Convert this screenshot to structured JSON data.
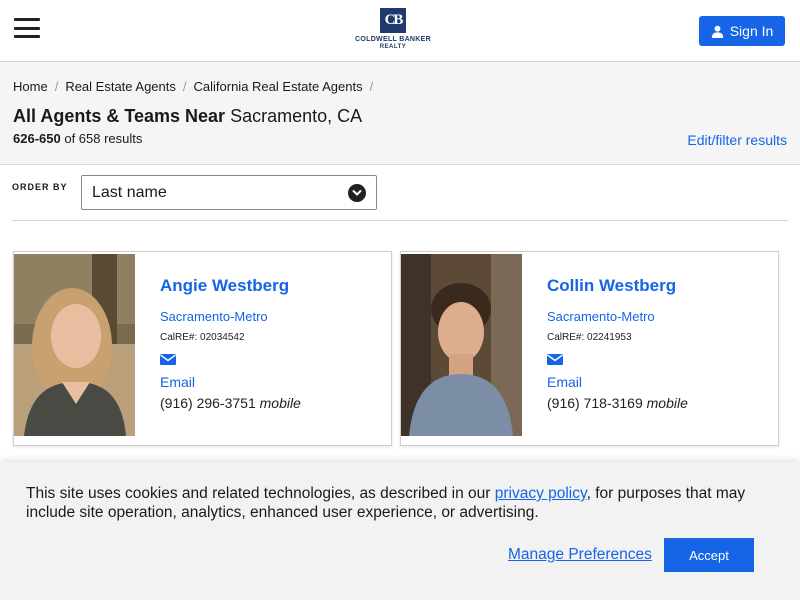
{
  "header": {
    "menu_icon": "hamburger-menu-icon",
    "logo": {
      "mark": "CB",
      "line1": "COLDWELL BANKER",
      "line2": "REALTY"
    },
    "signin_label": "Sign In",
    "signin_icon": "user-icon"
  },
  "breadcrumb": {
    "items": [
      "Home",
      "Real Estate Agents",
      "California Real Estate Agents"
    ],
    "separator": "/"
  },
  "summary": {
    "title_bold": "All Agents & Teams Near",
    "title_location": "Sacramento, CA",
    "range": "626-650",
    "of_text": "of 658 results",
    "edit_filter_label": "Edit/filter results"
  },
  "orderby": {
    "label": "ORDER BY",
    "selected": "Last name",
    "chevron_icon": "chevron-down-icon"
  },
  "agents": [
    {
      "name": "Angie Westberg",
      "office": "Sacramento-Metro",
      "license": "CalRE#: 02034542",
      "email_label": "Email",
      "phone": "(916) 296-3751",
      "phone_type": "mobile"
    },
    {
      "name": "Collin Westberg",
      "office": "Sacramento-Metro",
      "license": "CalRE#: 02241953",
      "email_label": "Email",
      "phone": "(916) 718-3169",
      "phone_type": "mobile"
    }
  ],
  "cookie": {
    "text_before": "This site uses cookies and related technologies, as described in our ",
    "link_label": "privacy policy",
    "text_after": ", for purposes that may include site operation, analytics, enhanced user experience, or advertising.",
    "manage_label": "Manage Preferences",
    "accept_label": "Accept"
  },
  "colors": {
    "accent": "#1565e6",
    "brand_navy": "#1f3a6d",
    "summary_bg": "#f5f5f5"
  }
}
